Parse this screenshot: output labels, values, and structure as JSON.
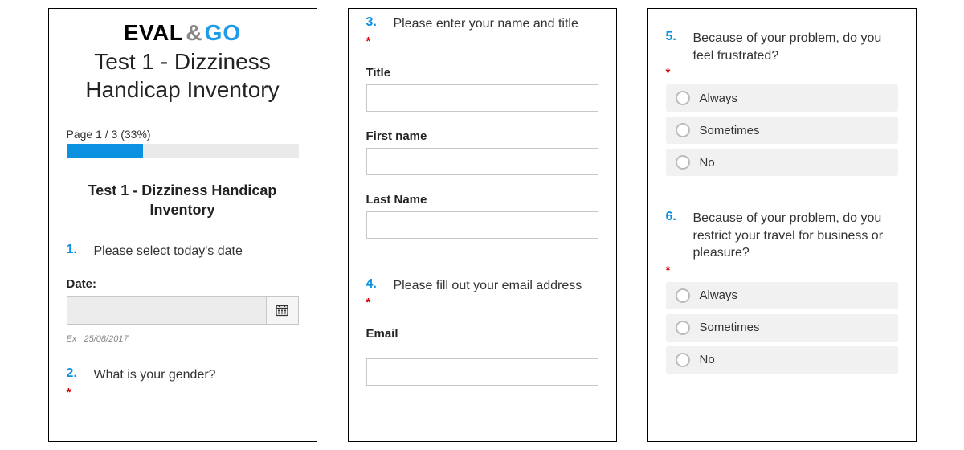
{
  "logo": {
    "eval": "EVAL",
    "amp": "&",
    "go": "GO"
  },
  "main_title": "Test 1 - Dizziness Handicap Inventory",
  "progress": {
    "label": "Page 1 / 3  (33%)",
    "percent": 33
  },
  "subtitle": "Test 1 - Dizziness Handicap Inventory",
  "q1": {
    "num": "1.",
    "text": "Please select today's date",
    "date_label": "Date:",
    "date_value": "",
    "hint": "Ex : 25/08/2017"
  },
  "q2": {
    "num": "2.",
    "text": "What is your gender?",
    "required": "*"
  },
  "q3": {
    "num": "3.",
    "text": "Please enter your name and title",
    "required": "*",
    "title_label": "Title",
    "first_label": "First name",
    "last_label": "Last Name",
    "title_value": "",
    "first_value": "",
    "last_value": ""
  },
  "q4": {
    "num": "4.",
    "text": "Please fill out your email address",
    "required": "*",
    "email_label": "Email",
    "email_value": ""
  },
  "q5": {
    "num": "5.",
    "text": "Because of your problem, do you feel frustrated?",
    "required": "*",
    "options": [
      "Always",
      "Sometimes",
      "No"
    ]
  },
  "q6": {
    "num": "6.",
    "text": "Because of your problem, do you restrict your travel for business or pleasure?",
    "required": "*",
    "options": [
      "Always",
      "Sometimes",
      "No"
    ]
  }
}
